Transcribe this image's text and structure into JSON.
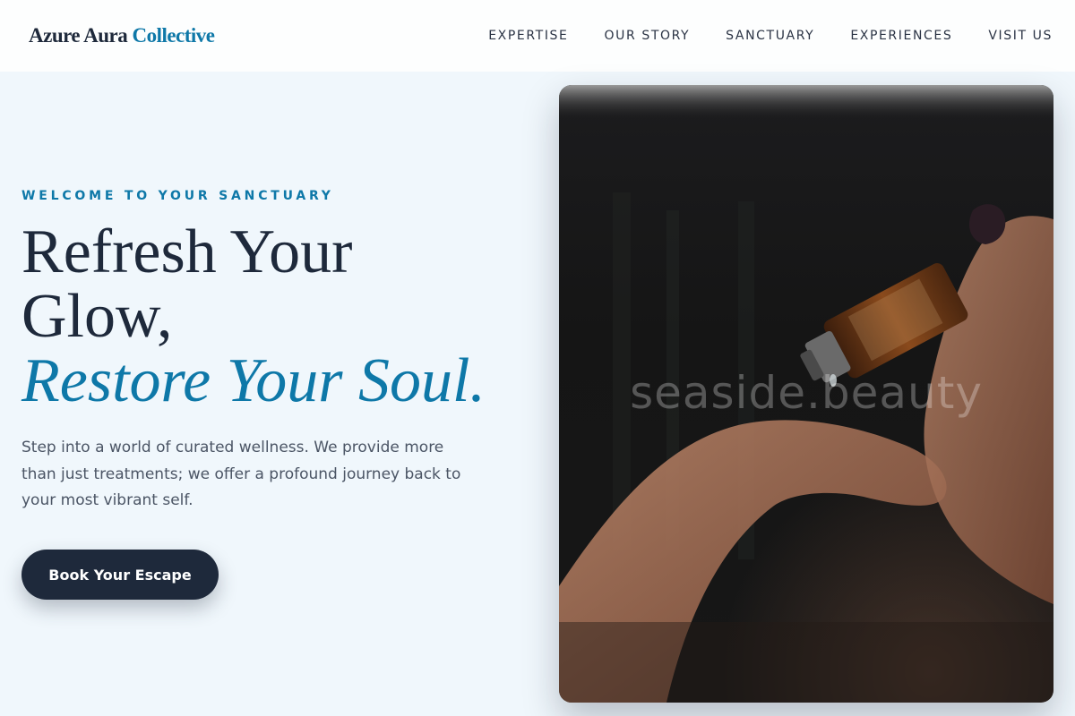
{
  "header": {
    "logo_main": "Azure Aura",
    "logo_accent": "Collective",
    "nav": [
      "EXPERTISE",
      "OUR STORY",
      "SANCTUARY",
      "EXPERIENCES",
      "VISIT US"
    ]
  },
  "hero": {
    "eyebrow": "WELCOME TO YOUR SANCTUARY",
    "headline_line1": "Refresh Your",
    "headline_line2": "Glow,",
    "headline_accent": "Restore Your Soul.",
    "description": "Step into a world of curated wellness. We provide more than just treatments; we offer a profound journey back to your most vibrant self.",
    "cta_label": "Book Your Escape",
    "image_watermark": "seaside.beauty"
  },
  "colors": {
    "accent": "#0e78a8",
    "dark": "#1e293b",
    "background": "#f0f7fc"
  }
}
